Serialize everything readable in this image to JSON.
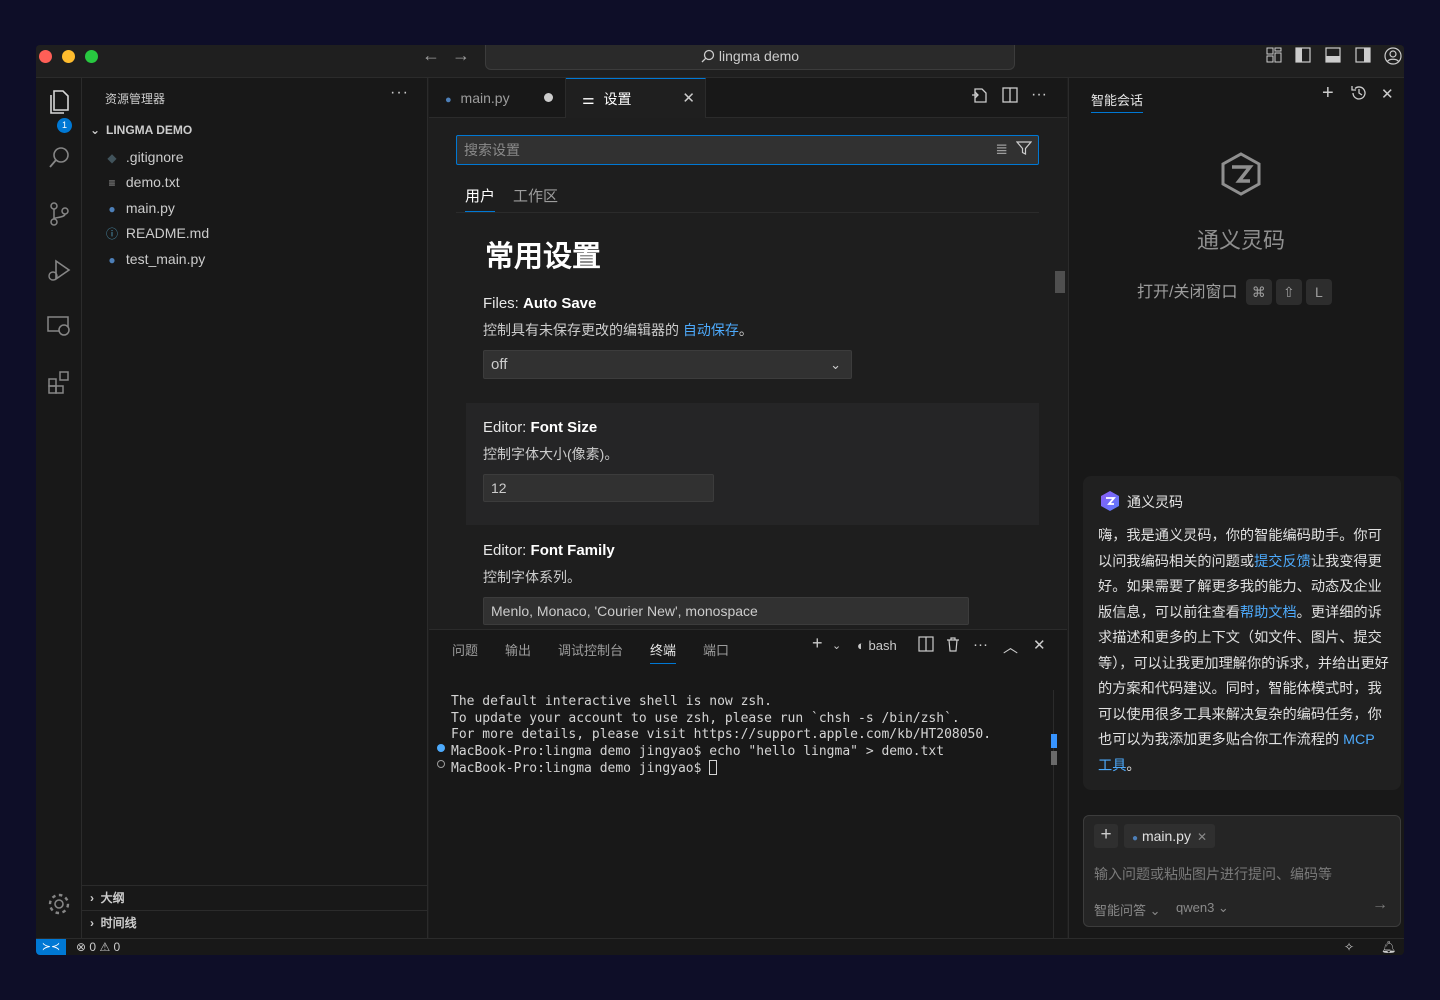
{
  "titlebar": {
    "search_text": "lingma demo",
    "nav_back": "←",
    "nav_forward": "→"
  },
  "activity": {
    "explorer_badge": "1"
  },
  "sidebar": {
    "title": "资源管理器",
    "more": "···",
    "project": "LINGMA DEMO",
    "files": [
      {
        "name": ".gitignore",
        "icon": "git-file-icon"
      },
      {
        "name": "demo.txt",
        "icon": "text-file-icon"
      },
      {
        "name": "main.py",
        "icon": "python-file-icon"
      },
      {
        "name": "README.md",
        "icon": "info-file-icon"
      },
      {
        "name": "test_main.py",
        "icon": "python-file-icon"
      }
    ],
    "outline": "大纲",
    "timeline": "时间线"
  },
  "editor": {
    "tabs": [
      {
        "label": "main.py",
        "modified": true
      },
      {
        "label": "设置",
        "active": true
      }
    ],
    "search_placeholder": "搜索设置",
    "scope_tabs": [
      "用户",
      "工作区"
    ],
    "heading": "常用设置",
    "settings": [
      {
        "category": "Files: ",
        "name": "Auto Save",
        "description": "控制具有未保存更改的编辑器的 ",
        "link": "自动保存",
        "description_end": "。",
        "value": "off"
      },
      {
        "category": "Editor: ",
        "name": "Font Size",
        "description": "控制字体大小(像素)。",
        "value": "12"
      },
      {
        "category": "Editor: ",
        "name": "Font Family",
        "description": "控制字体系列。",
        "value": "Menlo, Monaco, 'Courier New', monospace"
      }
    ]
  },
  "panel": {
    "tabs": [
      "问题",
      "输出",
      "调试控制台",
      "终端",
      "端口"
    ],
    "active_tab": "终端",
    "shell": "bash",
    "terminal_lines": [
      "The default interactive shell is now zsh.",
      "To update your account to use zsh, please run `chsh -s /bin/zsh`.",
      "For more details, please visit https://support.apple.com/kb/HT208050.",
      "MacBook-Pro:lingma demo jingyao$ echo \"hello lingma\" > demo.txt",
      "MacBook-Pro:lingma demo jingyao$ "
    ]
  },
  "chat": {
    "title": "智能会话",
    "brand": "通义灵码",
    "shortcut_label": "打开/关闭窗口",
    "shortcut_keys": [
      "⌘",
      "⇧",
      "L"
    ],
    "message_author": "通义灵码",
    "message": {
      "p1": "嗨，我是通义灵码，你的智能编码助手。你可以问我编码相关的问题或",
      "link1": "提交反馈",
      "p2": "让我变得更好。如果需要了解更多我的能力、动态及企业版信息，可以前往查看",
      "link2": "帮助文档",
      "p3": "。更详细的诉求描述和更多的上下文（如文件、图片、提交等），可以让我更加理解你的诉求，并给出更好的方案和代码建议。同时，智能体模式时，我可以使用很多工具来解决复杂的编码任务，你也可以为我添加更多贴合你工作流程的 ",
      "link3": "MCP 工具",
      "p4": "。"
    },
    "context_file": "main.py",
    "input_placeholder": "输入问题或粘贴图片进行提问、编码等",
    "mode": "智能问答",
    "model": "qwen3"
  },
  "statusbar": {
    "errors": "0",
    "warnings": "0"
  },
  "colors": {
    "accent": "#0078d4",
    "link": "#4daafc"
  }
}
